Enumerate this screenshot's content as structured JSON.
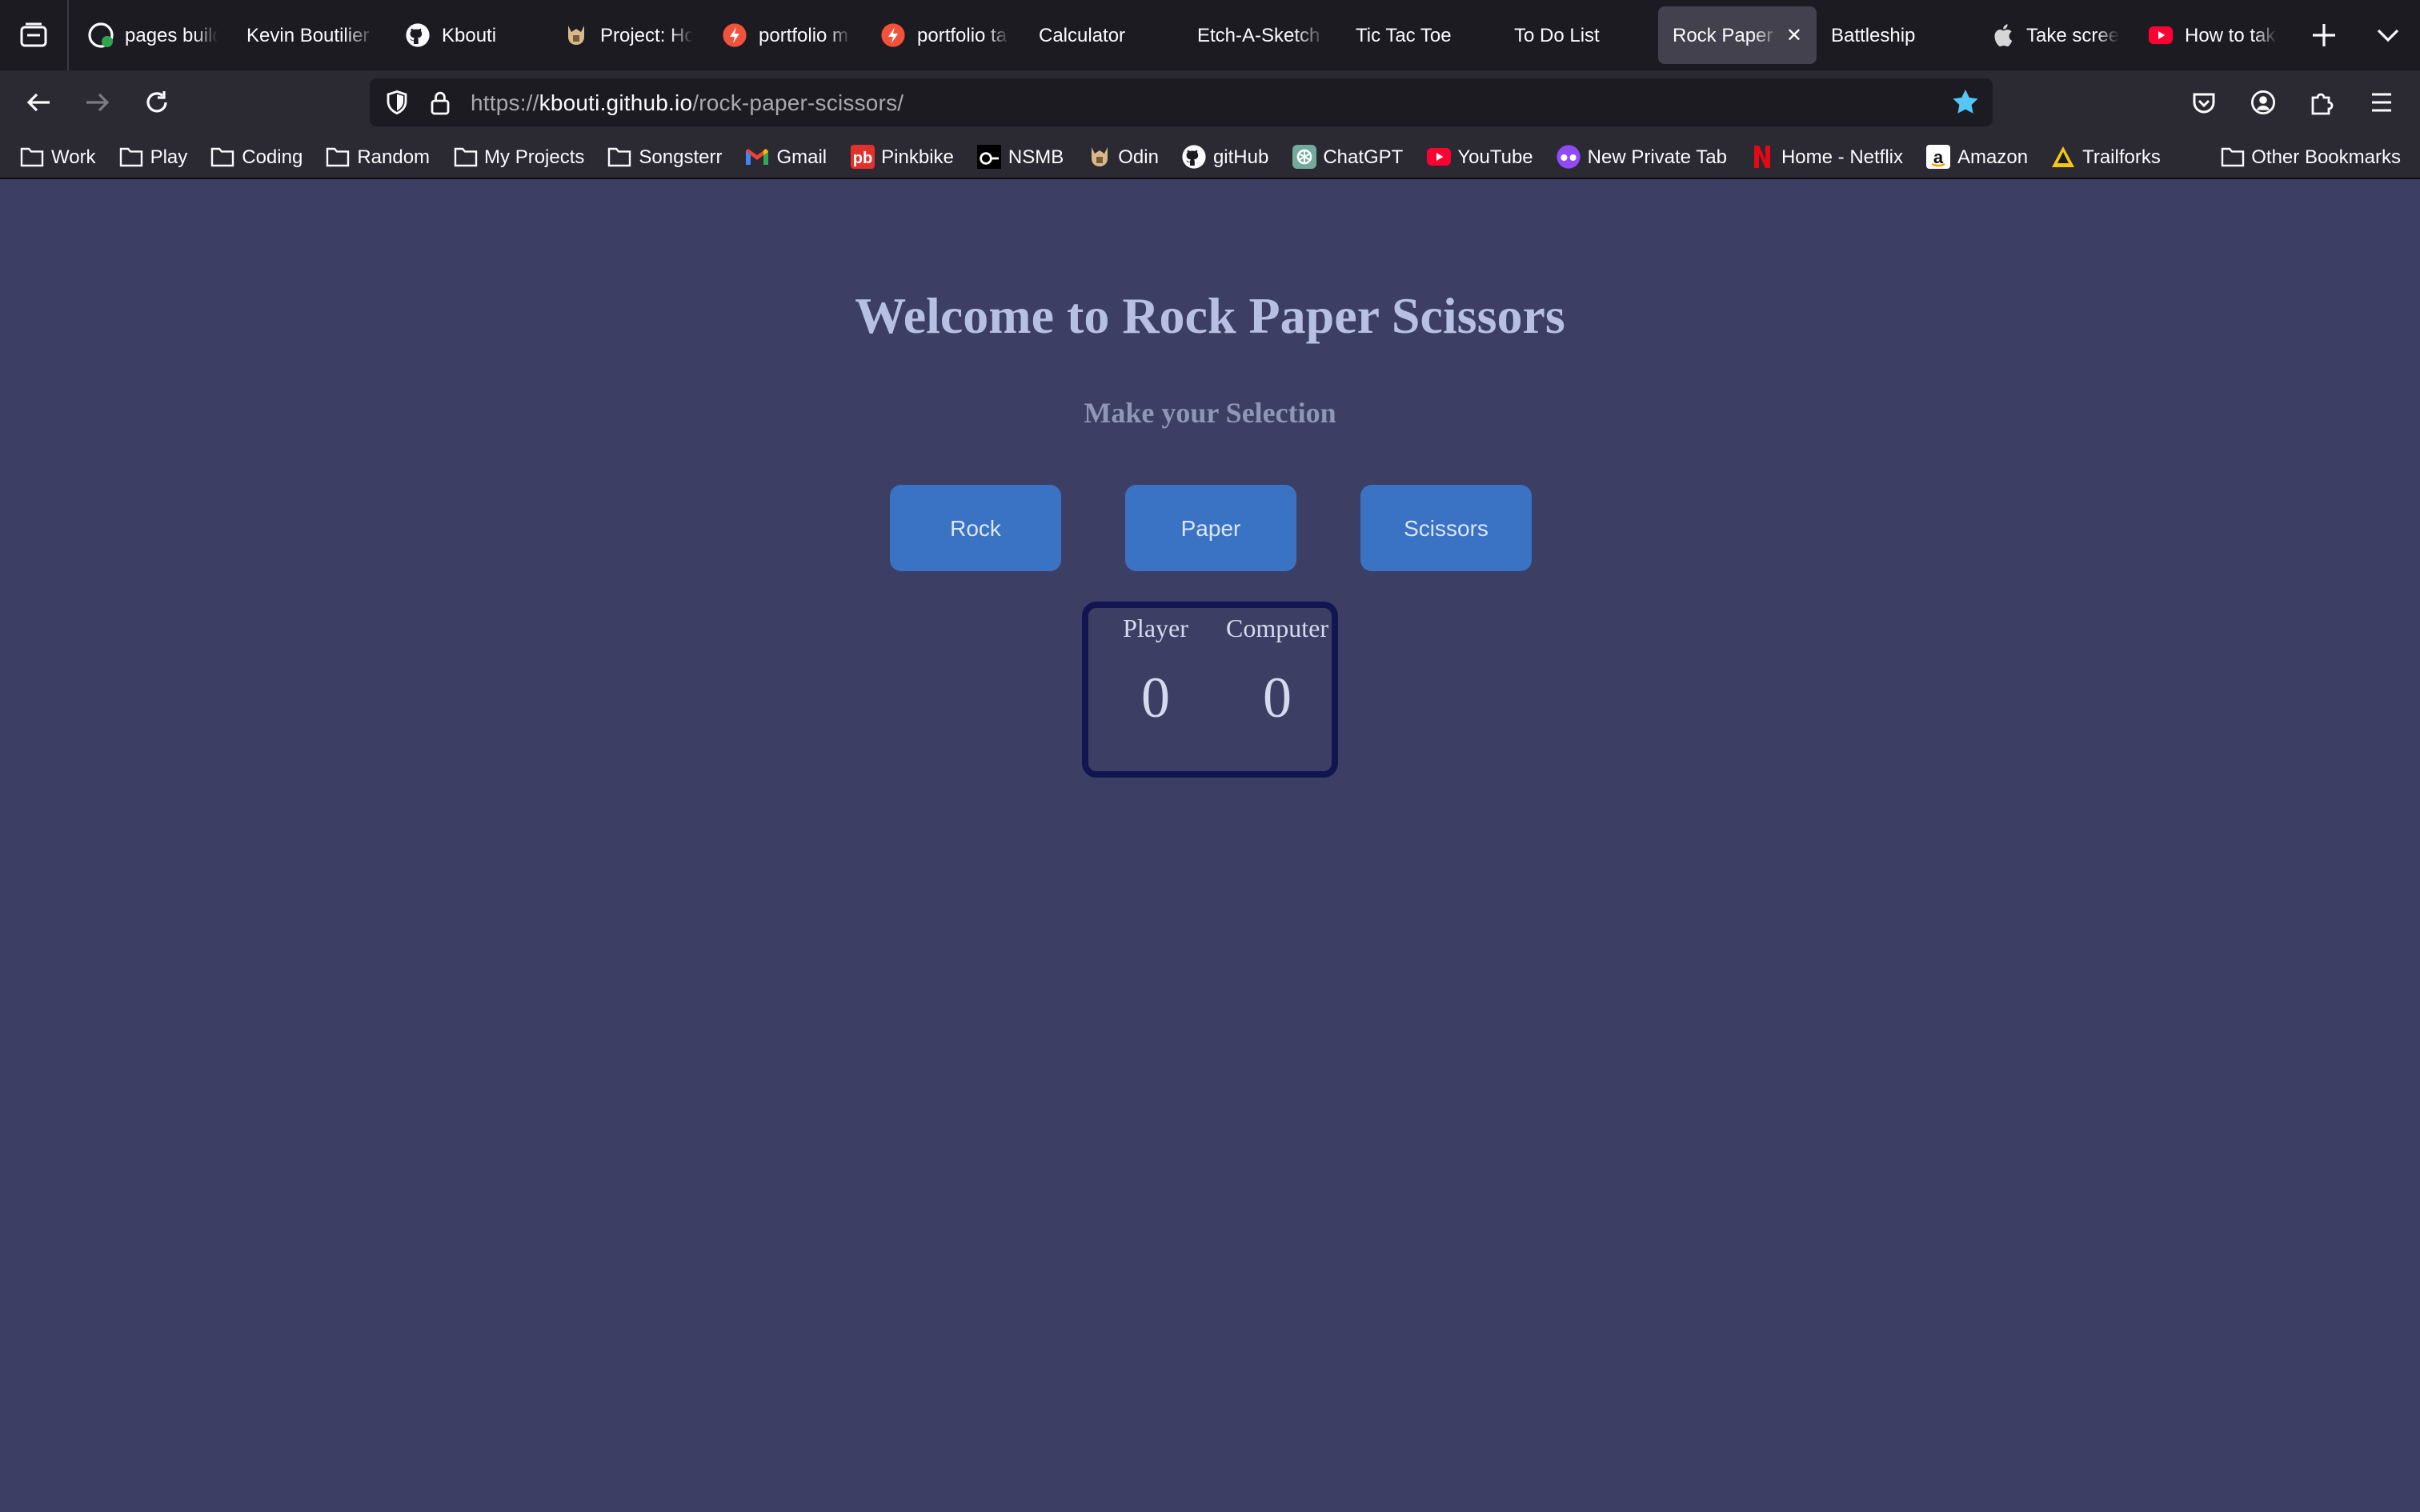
{
  "tabs": [
    {
      "label": "pages build",
      "icon": "github-check-icon",
      "active": false
    },
    {
      "label": "Kevin Boutilier",
      "icon": "none",
      "active": false
    },
    {
      "label": "Kbouti",
      "icon": "github-icon",
      "active": false
    },
    {
      "label": "Project: Ho",
      "icon": "odin-icon",
      "active": false
    },
    {
      "label": "portfolio m",
      "icon": "lightning-icon",
      "active": false
    },
    {
      "label": "portfolio ta",
      "icon": "lightning-icon",
      "active": false
    },
    {
      "label": "Calculator",
      "icon": "none",
      "active": false
    },
    {
      "label": "Etch-A-Sketch",
      "icon": "none",
      "active": false
    },
    {
      "label": "Tic Tac Toe",
      "icon": "none",
      "active": false
    },
    {
      "label": "To Do List",
      "icon": "none",
      "active": false
    },
    {
      "label": "Rock Paper",
      "icon": "none",
      "active": true
    },
    {
      "label": "Battleship",
      "icon": "none",
      "active": false
    },
    {
      "label": "Take scree",
      "icon": "apple-icon",
      "active": false
    },
    {
      "label": "How to take",
      "icon": "youtube-icon",
      "active": false
    }
  ],
  "url": {
    "scheme": "https://",
    "host": "kbouti.github.io",
    "path": "/rock-paper-scissors/"
  },
  "bookmarks": [
    {
      "label": "Work",
      "icon": "folder-icon"
    },
    {
      "label": "Play",
      "icon": "folder-icon"
    },
    {
      "label": "Coding",
      "icon": "folder-icon"
    },
    {
      "label": "Random",
      "icon": "folder-icon"
    },
    {
      "label": "My Projects",
      "icon": "folder-icon"
    },
    {
      "label": "Songsterr",
      "icon": "folder-icon"
    },
    {
      "label": "Gmail",
      "icon": "gmail-icon"
    },
    {
      "label": "Pinkbike",
      "icon": "pinkbike-icon"
    },
    {
      "label": "NSMB",
      "icon": "nsmb-icon"
    },
    {
      "label": "Odin",
      "icon": "odin-icon"
    },
    {
      "label": "gitHub",
      "icon": "github-icon"
    },
    {
      "label": "ChatGPT",
      "icon": "chatgpt-icon"
    },
    {
      "label": "YouTube",
      "icon": "youtube-icon"
    },
    {
      "label": "New Private Tab",
      "icon": "private-icon"
    },
    {
      "label": "Home - Netflix",
      "icon": "netflix-icon"
    },
    {
      "label": "Amazon",
      "icon": "amazon-icon"
    },
    {
      "label": "Trailforks",
      "icon": "trailforks-icon"
    }
  ],
  "other_bookmarks": "Other Bookmarks",
  "page": {
    "title": "Welcome to Rock Paper Scissors",
    "subtitle": "Make your Selection",
    "choices": [
      "Rock",
      "Paper",
      "Scissors"
    ],
    "score": {
      "player_label": "Player",
      "player_value": "0",
      "computer_label": "Computer",
      "computer_value": "0"
    }
  },
  "colors": {
    "page_bg": "#3c3f63",
    "button_bg": "#3a72c4",
    "scoreboard_border": "#121552",
    "bookmark_star": "#54c7f6"
  }
}
